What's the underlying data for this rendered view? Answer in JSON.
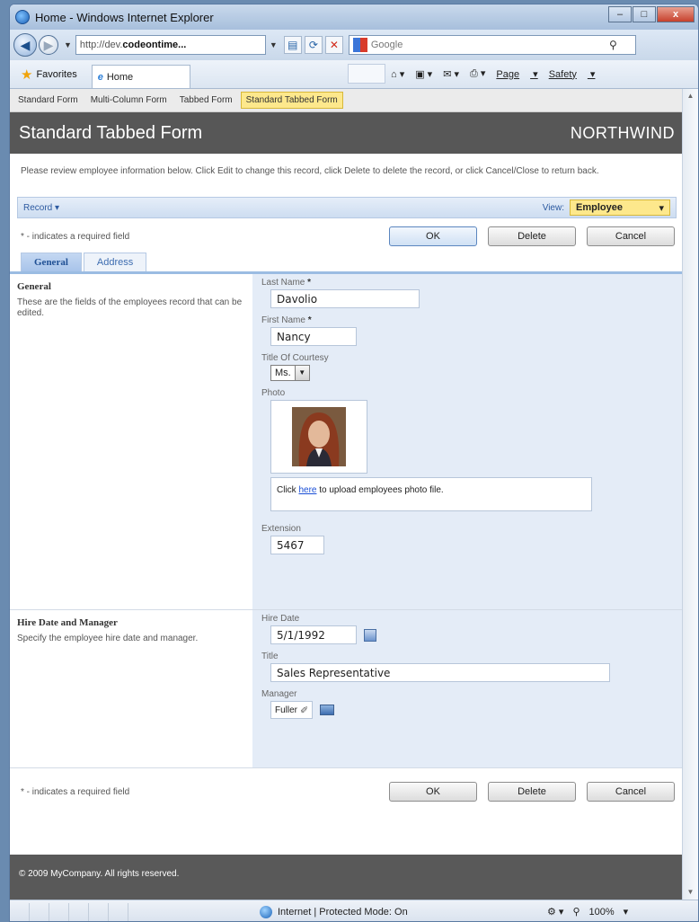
{
  "window": {
    "title": "Home - Windows Internet Explorer",
    "min": "–",
    "max": "□",
    "close": "x"
  },
  "nav": {
    "url_prefix": "http://dev.",
    "url_bold": "codeontime...",
    "search_placeholder": "Google"
  },
  "favbar": {
    "favorites": "Favorites",
    "home_tab": "Home",
    "page": "Page",
    "safety": "Safety"
  },
  "form_tabs": [
    "Standard Form",
    "Multi-Column Form",
    "Tabbed Form",
    "Standard Tabbed Form"
  ],
  "banner": {
    "title": "Standard Tabbed Form",
    "brand": "NORTHWIND"
  },
  "intro": "Please review employee information below. Click Edit to change this record, click Delete to delete the record, or click Cancel/Close to return back.",
  "record_bar": {
    "record": "Record ▾",
    "view_label": "View:",
    "view_value": "Employee",
    "view_arrow": "▾"
  },
  "actions": {
    "required_note": "* - indicates a required field",
    "ok": "OK",
    "delete": "Delete",
    "cancel": "Cancel"
  },
  "content_tabs": [
    "General",
    "Address"
  ],
  "general": {
    "heading": "General",
    "description": "These are the fields of the employees record that can be edited.",
    "last_name_label": "Last Name",
    "last_name": "Davolio",
    "first_name_label": "First Name",
    "first_name": "Nancy",
    "required_mark": "*",
    "courtesy_label": "Title Of Courtesy",
    "courtesy": "Ms.",
    "photo_label": "Photo",
    "upload_pre": "Click",
    "upload_link": "here",
    "upload_post": "to upload employees photo file.",
    "extension_label": "Extension",
    "extension": "5467"
  },
  "hire": {
    "heading": "Hire Date and Manager",
    "description": "Specify the employee hire date and manager.",
    "hire_date_label": "Hire Date",
    "hire_date": "5/1/1992",
    "title_label": "Title",
    "title": "Sales Representative",
    "manager_label": "Manager",
    "manager": "Fuller"
  },
  "footer": "© 2009 MyCompany. All rights reserved.",
  "status": {
    "zone": "Internet | Protected Mode: On",
    "zoom": "100%"
  }
}
